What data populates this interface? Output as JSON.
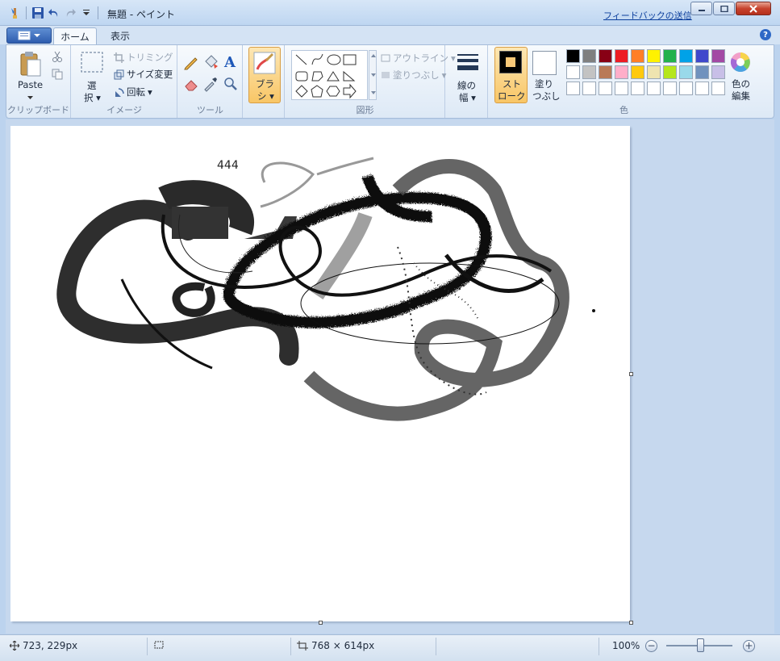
{
  "window": {
    "title": "無題 - ペイント",
    "feedback_link": "フィードバックの送信"
  },
  "tabs": [
    {
      "label": "ホーム",
      "active": true
    },
    {
      "label": "表示",
      "active": false
    }
  ],
  "ribbon": {
    "clipboard": {
      "paste_label": "Paste",
      "group_label": "クリップボード"
    },
    "image": {
      "select_label": "選",
      "select_label2": "択",
      "crop_label": "トリミング",
      "resize_label": "サイズ変更",
      "rotate_label": "回転",
      "group_label": "イメージ"
    },
    "tools": {
      "group_label": "ツール"
    },
    "brush": {
      "label1": "ブラ",
      "label2": "シ"
    },
    "shapes": {
      "outline_label": "アウトライン",
      "fill_label": "塗りつぶし",
      "group_label": "図形"
    },
    "size": {
      "label1": "線の",
      "label2": "幅"
    },
    "colors": {
      "color1_label1": "スト",
      "color1_label2": "ローク",
      "color2_label1": "塗り",
      "color2_label2": "つぶし",
      "edit_label1": "色の",
      "edit_label2": "編集",
      "group_label": "色",
      "color1_value": "#000000",
      "color2_value": "#ffffff",
      "palette_row1": [
        "#000000",
        "#7f7f7f",
        "#880015",
        "#ed1c24",
        "#ff7f27",
        "#fff200",
        "#22b14c",
        "#00a2e8",
        "#3f48cc",
        "#a349a4"
      ],
      "palette_row2": [
        "#ffffff",
        "#c3c3c3",
        "#b97a57",
        "#ffaec9",
        "#ffc90e",
        "#efe4b0",
        "#b5e61d",
        "#99d9ea",
        "#7092be",
        "#c8bfe7"
      ],
      "palette_row3": [
        "#ffffff",
        "#ffffff",
        "#ffffff",
        "#ffffff",
        "#ffffff",
        "#ffffff",
        "#ffffff",
        "#ffffff",
        "#ffffff",
        "#ffffff"
      ]
    }
  },
  "canvas": {
    "text": "444"
  },
  "status": {
    "cursor_pos": "723, 229px",
    "canvas_size": "768 × 614px",
    "zoom": "100%"
  }
}
